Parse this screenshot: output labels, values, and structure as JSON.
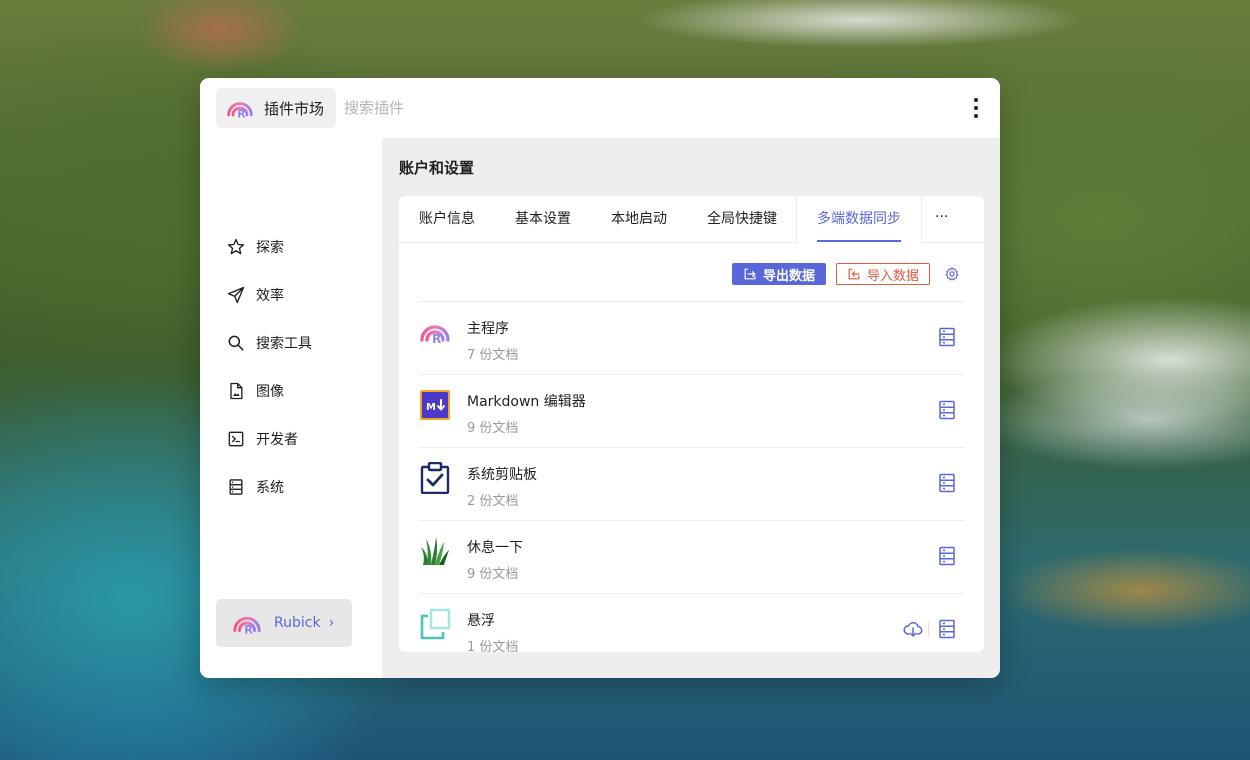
{
  "window": {
    "title": "插件市场",
    "search_placeholder": "搜索插件"
  },
  "sidebar": {
    "items": [
      {
        "label": "探索",
        "icon": "star-icon"
      },
      {
        "label": "效率",
        "icon": "send-icon"
      },
      {
        "label": "搜索工具",
        "icon": "search-icon"
      },
      {
        "label": "图像",
        "icon": "image-file-icon"
      },
      {
        "label": "开发者",
        "icon": "terminal-icon"
      },
      {
        "label": "系统",
        "icon": "database-icon"
      }
    ],
    "user": {
      "name": "Rubick",
      "chevron": "›"
    }
  },
  "main": {
    "title": "账户和设置",
    "tabs": [
      {
        "label": "账户信息"
      },
      {
        "label": "基本设置"
      },
      {
        "label": "本地启动"
      },
      {
        "label": "全局快捷键"
      },
      {
        "label": "多端数据同步",
        "active": true
      }
    ],
    "more_tabs": "···",
    "actions": {
      "export_label": "导出数据",
      "import_label": "导入数据"
    },
    "plugins": [
      {
        "name": "主程序",
        "count": "7 份文档",
        "icon": "rubick-logo-icon",
        "cloud": false
      },
      {
        "name": "Markdown 编辑器",
        "count": "9 份文档",
        "icon": "markdown-icon",
        "cloud": false
      },
      {
        "name": "系统剪贴板",
        "count": "2 份文档",
        "icon": "clipboard-check-icon",
        "cloud": false
      },
      {
        "name": "休息一下",
        "count": "9 份文档",
        "icon": "grass-icon",
        "cloud": false
      },
      {
        "name": "悬浮",
        "count": "1 份文档",
        "icon": "float-window-icon",
        "cloud": true
      }
    ]
  },
  "colors": {
    "accent": "#5867d9",
    "danger": "#e35b41",
    "muted": "#999999"
  }
}
